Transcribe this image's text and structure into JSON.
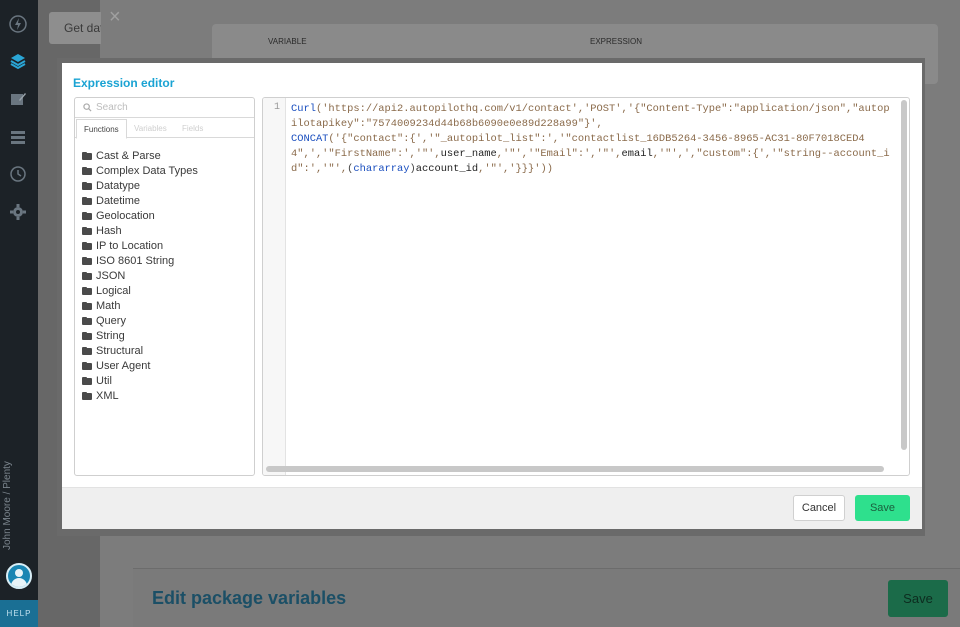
{
  "sidebar": {
    "icons": [
      "bolt-icon",
      "layers-icon",
      "edit-icon",
      "list-icon",
      "history-icon",
      "gear-icon"
    ],
    "user_label": "John Moore / Plenty",
    "help_label": "HELP"
  },
  "background": {
    "tab_label": "Get dat",
    "table_headers": {
      "variable": "VARIABLE",
      "expression": "EXPRESSION"
    },
    "page_title": "Edit package variables",
    "save_label": "Save"
  },
  "modal": {
    "title": "Expression editor",
    "search_placeholder": "Search",
    "tabs": [
      {
        "label": "Functions",
        "active": true
      },
      {
        "label": "Variables",
        "active": false
      },
      {
        "label": "Fields",
        "active": false
      }
    ],
    "categories": [
      "Cast & Parse",
      "Complex Data Types",
      "Datatype",
      "Datetime",
      "Geolocation",
      "Hash",
      "IP to Location",
      "ISO 8601 String",
      "JSON",
      "Logical",
      "Math",
      "Query",
      "String",
      "Structural",
      "User Agent",
      "Util",
      "XML"
    ],
    "editor": {
      "line_number": "1",
      "fn_curl": "Curl",
      "fn_concat": "CONCAT",
      "cast_chararray": "chararray",
      "var_user_name": "user_name",
      "var_email": "email",
      "var_account_id": "account_id",
      "seg1": "('https://api2.autopilothq.com/v1/contact','POST','{\"Content-Type\":\"application/json\",\"autopilotapikey\":\"7574009234d44b68b6090e0e89d228a99\"}',\n",
      "seg2": "('{\"contact\":{','\"_autopilot_list\":','\"contactlist_16DB5264-3456-8965-AC31-80F7018CED44\",','\"FirstName\":','\"',",
      "seg3": ",'\"','\"Email\":','\"',",
      "seg4": ",'\"',',\"custom\":{','\"string--account_id\":','\"',",
      "seg5": ",'\"','}}}'))"
    },
    "cancel_label": "Cancel",
    "save_label": "Save"
  }
}
